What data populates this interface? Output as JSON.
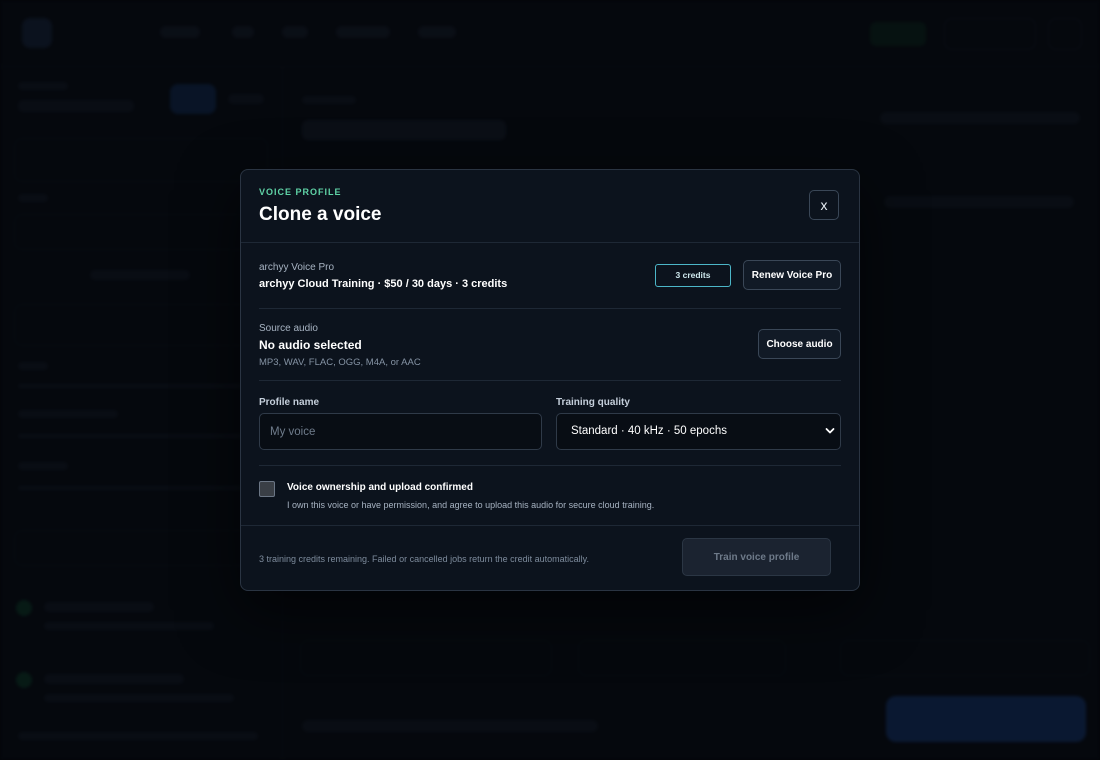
{
  "modal": {
    "eyebrow": "VOICE PROFILE",
    "title": "Clone a voice",
    "close_label": "x",
    "plan": {
      "name": "archyy Voice Pro",
      "details": "archyy Cloud Training · $50 / 30 days · 3 credits",
      "credits_badge": "3 credits",
      "renew_label": "Renew Voice Pro"
    },
    "source_audio": {
      "label": "Source audio",
      "value": "No audio selected",
      "formats": "MP3, WAV, FLAC, OGG, M4A, or AAC",
      "choose_label": "Choose audio"
    },
    "profile_name": {
      "label": "Profile name",
      "placeholder": "My voice",
      "value": ""
    },
    "training_quality": {
      "label": "Training quality",
      "selected": "Standard · 40 kHz · 50 epochs"
    },
    "consent": {
      "checked": false,
      "title": "Voice ownership and upload confirmed",
      "description": "I own this voice or have permission, and agree to upload this audio for secure cloud training."
    },
    "footer": {
      "note": "3 training credits remaining. Failed or cancelled jobs return the credit automatically.",
      "train_label": "Train voice profile",
      "train_disabled": true
    }
  },
  "colors": {
    "accent_green": "#5fd3a6",
    "badge_border": "#4cb6c8",
    "modal_bg": "#0c131d",
    "page_bg": "#0b1018"
  }
}
